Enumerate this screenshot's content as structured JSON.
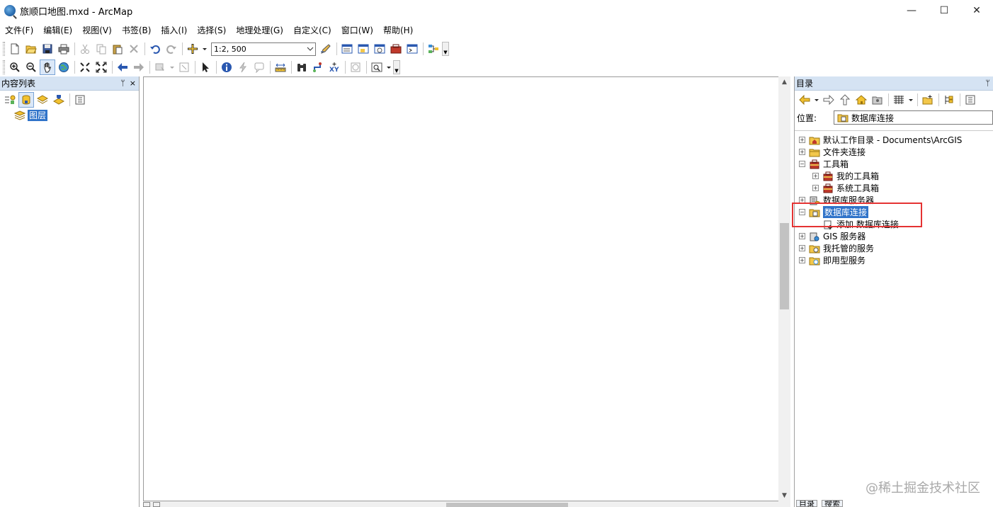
{
  "window": {
    "title": "旅顺口地图.mxd - ArcMap",
    "minimize": "—",
    "maximize": "☐",
    "close": "✕"
  },
  "menu": [
    "文件(F)",
    "编辑(E)",
    "视图(V)",
    "书签(B)",
    "插入(I)",
    "选择(S)",
    "地理处理(G)",
    "自定义(C)",
    "窗口(W)",
    "帮助(H)"
  ],
  "toolbar": {
    "scale_value": "1:2, 500"
  },
  "toc": {
    "title": "内容列表",
    "pin": "ᛘ",
    "close": "×",
    "layers_label": "图层"
  },
  "catalog": {
    "title": "目录",
    "pin": "ᛘ",
    "location_label": "位置:",
    "location_value": "数据库连接",
    "tree": [
      {
        "label": "默认工作目录 - Documents\\ArcGIS",
        "expander": "+",
        "level": 0,
        "icon": "home-folder-icon"
      },
      {
        "label": "文件夹连接",
        "expander": "+",
        "level": 0,
        "icon": "folder-connection-icon"
      },
      {
        "label": "工具箱",
        "expander": "−",
        "level": 0,
        "icon": "toolbox-icon"
      },
      {
        "label": "我的工具箱",
        "expander": "+",
        "level": 1,
        "icon": "toolbox-icon"
      },
      {
        "label": "系统工具箱",
        "expander": "+",
        "level": 1,
        "icon": "toolbox-icon"
      },
      {
        "label": "数据库服务器",
        "expander": "+",
        "level": 0,
        "icon": "database-server-icon"
      },
      {
        "label": "数据库连接",
        "expander": "−",
        "level": 0,
        "icon": "database-connection-icon",
        "selected": true
      },
      {
        "label": "添加 数据库连接",
        "expander": "",
        "level": 1,
        "icon": "add-connection-icon"
      },
      {
        "label": "GIS 服务器",
        "expander": "+",
        "level": 0,
        "icon": "gis-server-icon"
      },
      {
        "label": "我托管的服务",
        "expander": "+",
        "level": 0,
        "icon": "hosted-services-icon"
      },
      {
        "label": "即用型服务",
        "expander": "+",
        "level": 0,
        "icon": "ready-services-icon"
      }
    ],
    "bottom_tabs": [
      "目录",
      "搜索"
    ]
  },
  "watermark": "@稀土掘金技术社区",
  "colors": {
    "panel_header": "#d5e3f3",
    "selection": "#2f73c9",
    "highlight_border": "#e53333"
  }
}
